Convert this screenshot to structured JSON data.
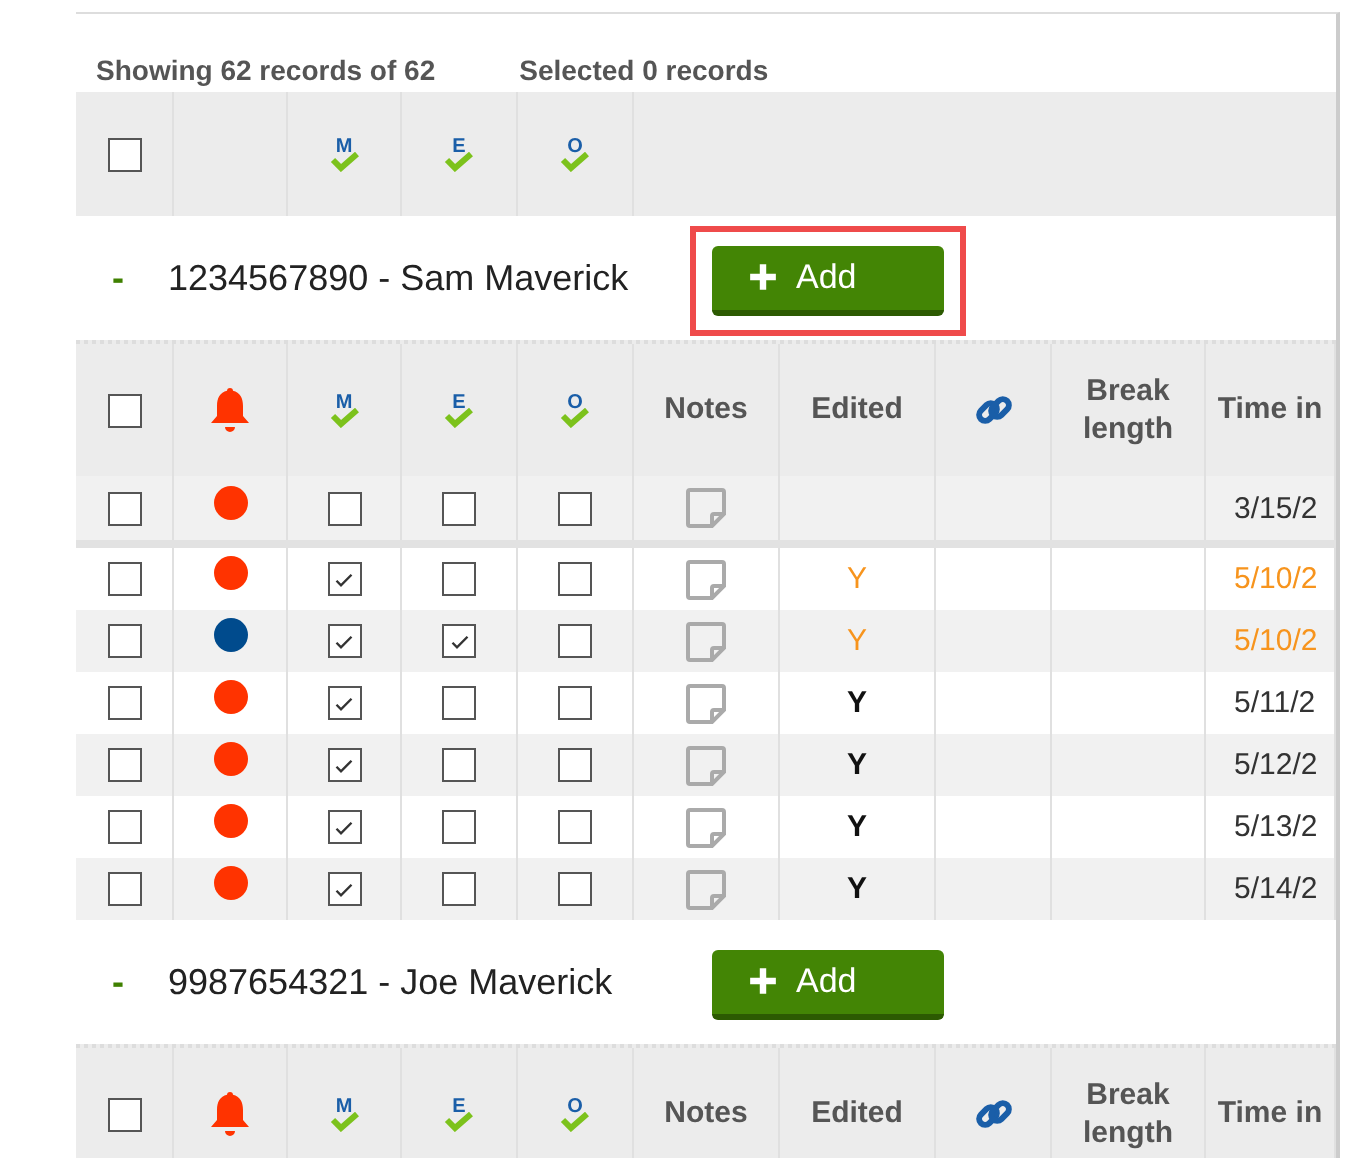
{
  "summary": {
    "showing": "Showing 62 records of 62",
    "selected": "Selected 0 records"
  },
  "top_header": {
    "checked": false,
    "flags": [
      "M",
      "E",
      "O"
    ]
  },
  "groups": [
    {
      "toggle": "-",
      "title": "1234567890 - Sam Maverick",
      "button": "Add",
      "highlighted": true,
      "columns": [
        {
          "kind": "select",
          "checked": false
        },
        {
          "kind": "alert"
        },
        {
          "kind": "flag",
          "letter": "M"
        },
        {
          "kind": "flag",
          "letter": "E"
        },
        {
          "kind": "flag",
          "letter": "O"
        },
        {
          "kind": "text",
          "label": "Notes"
        },
        {
          "kind": "text",
          "label": "Edited"
        },
        {
          "kind": "link"
        },
        {
          "kind": "text",
          "label": "Break length"
        },
        {
          "kind": "text",
          "label": "Time in"
        }
      ],
      "rows": [
        {
          "checked": false,
          "color": "#ff3300",
          "m": false,
          "e": false,
          "o": false,
          "edited": "",
          "changed": false,
          "time_in": "3/15/2"
        },
        {
          "checked": false,
          "color": "#ff3300",
          "m": true,
          "e": false,
          "o": false,
          "edited": "Y",
          "changed": true,
          "time_in": "5/10/2"
        },
        {
          "checked": false,
          "color": "#004b8d",
          "m": true,
          "e": true,
          "o": false,
          "edited": "Y",
          "changed": true,
          "time_in": "5/10/2"
        },
        {
          "checked": false,
          "color": "#ff3300",
          "m": true,
          "e": false,
          "o": false,
          "edited": "Y",
          "changed": false,
          "time_in": "5/11/2"
        },
        {
          "checked": false,
          "color": "#ff3300",
          "m": true,
          "e": false,
          "o": false,
          "edited": "Y",
          "changed": false,
          "time_in": "5/12/2"
        },
        {
          "checked": false,
          "color": "#ff3300",
          "m": true,
          "e": false,
          "o": false,
          "edited": "Y",
          "changed": false,
          "time_in": "5/13/2"
        },
        {
          "checked": false,
          "color": "#ff3300",
          "m": true,
          "e": false,
          "o": false,
          "edited": "Y",
          "changed": false,
          "time_in": "5/14/2"
        }
      ]
    },
    {
      "toggle": "-",
      "title": "9987654321 - Joe Maverick",
      "button": "Add",
      "highlighted": false,
      "columns": [
        {
          "kind": "select",
          "checked": false
        },
        {
          "kind": "alert"
        },
        {
          "kind": "flag",
          "letter": "M"
        },
        {
          "kind": "flag",
          "letter": "E"
        },
        {
          "kind": "flag",
          "letter": "O"
        },
        {
          "kind": "text",
          "label": "Notes"
        },
        {
          "kind": "text",
          "label": "Edited"
        },
        {
          "kind": "link"
        },
        {
          "kind": "text",
          "label": "Break length"
        },
        {
          "kind": "text",
          "label": "Time in"
        }
      ]
    }
  ]
}
